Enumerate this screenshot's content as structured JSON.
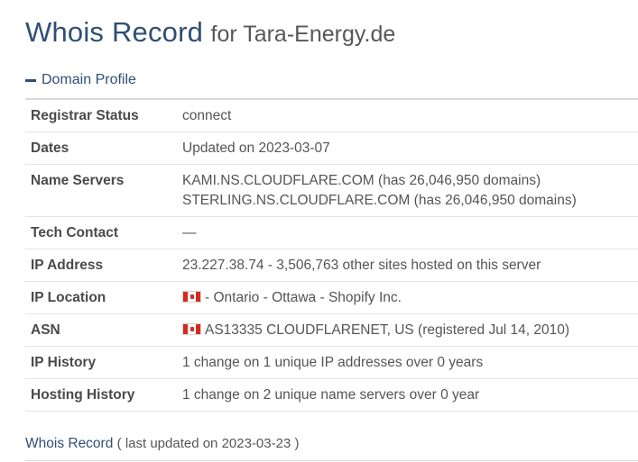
{
  "title": {
    "main": "Whois Record",
    "sub": "for Tara-Energy.de"
  },
  "section": {
    "label": "Domain Profile"
  },
  "rows": [
    {
      "label": "Registrar Status",
      "value": "connect"
    },
    {
      "label": "Dates",
      "value": "Updated on 2023-03-07"
    },
    {
      "label": "Name Servers",
      "ns1": "KAMI.NS.CLOUDFLARE.COM",
      "ns1_count": "(has 26,046,950 domains)",
      "ns2": "STERLING.NS.CLOUDFLARE.COM",
      "ns2_count": "(has 26,046,950 domains)"
    },
    {
      "label": "Tech Contact",
      "value": "—"
    },
    {
      "label": "IP Address",
      "ip": "23.227.38.74",
      "rest": "- 3,506,763 other sites hosted on this server"
    },
    {
      "label": "IP Location",
      "value": "- Ontario - Ottawa - Shopify Inc.",
      "flag_icon": "canada-flag-icon"
    },
    {
      "label": "ASN",
      "value": "AS13335 CLOUDFLARENET, US",
      "registered": "(registered Jul 14, 2010)",
      "flag_icon": "canada-flag-icon"
    },
    {
      "label": "IP History",
      "value": "1 change on 1 unique IP addresses over 0 years"
    },
    {
      "label": "Hosting History",
      "value": "1 change on 2 unique name servers over 0 year"
    }
  ],
  "whois_record": {
    "label": "Whois Record",
    "updated": "( last updated on 2023-03-23 )"
  },
  "colors": {
    "accent": "#2f4f75",
    "text": "#555555",
    "border": "#e3e3e3"
  }
}
